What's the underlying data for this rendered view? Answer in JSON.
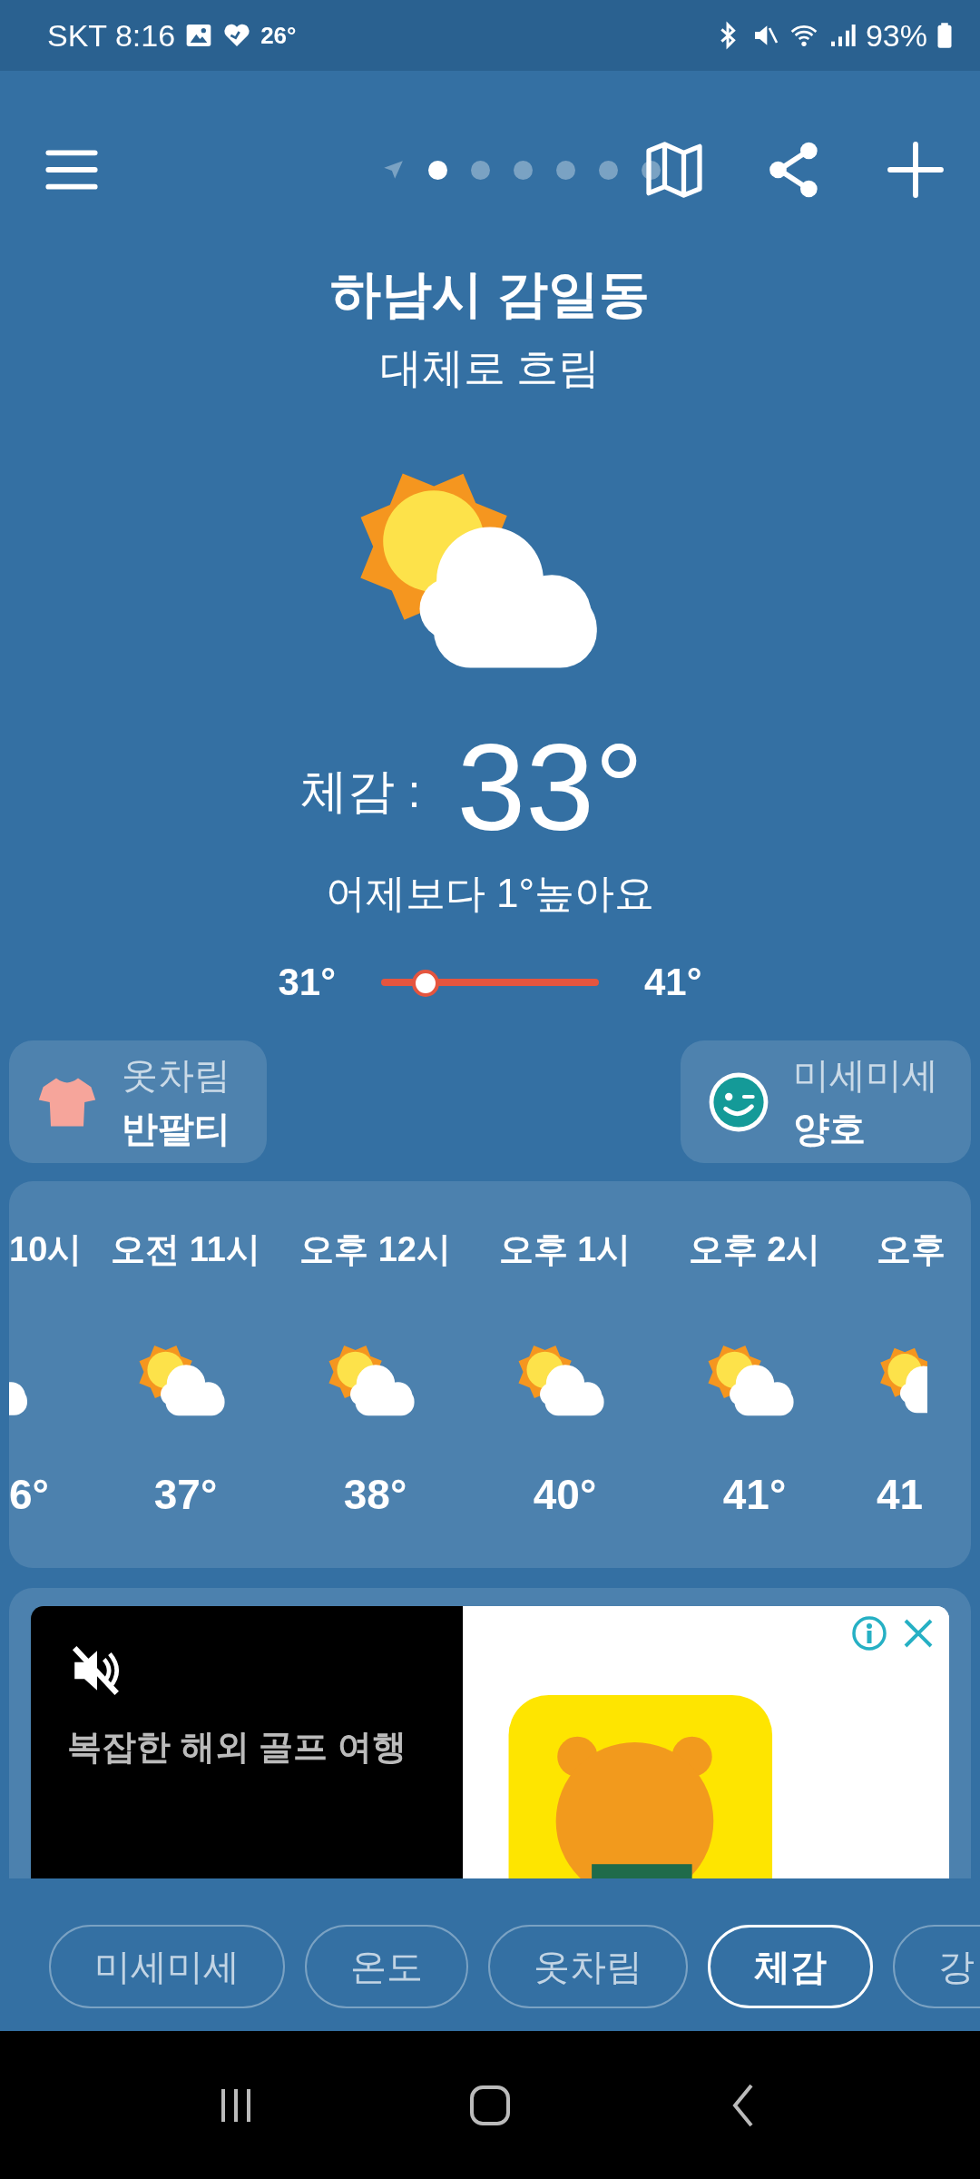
{
  "status_bar": {
    "carrier_time": "SKT 8:16",
    "temp": "26°",
    "battery": "93%"
  },
  "page_dots": [
    {
      "selected": true
    },
    {
      "selected": false
    },
    {
      "selected": false
    },
    {
      "selected": false
    },
    {
      "selected": false
    },
    {
      "selected": false
    }
  ],
  "location": {
    "name": "하남시 감일동",
    "condition": "대체로 흐림"
  },
  "feels_like": {
    "label": "체감 :",
    "value": "33°"
  },
  "comparison": "어제보다 1°높아요",
  "range": {
    "min": "31°",
    "max": "41°",
    "level": 0.2
  },
  "cards": [
    {
      "kind": "shirt",
      "title": "옷차림",
      "value": "반팔티"
    },
    {
      "kind": "dust",
      "title": "미세미세",
      "value": "양호"
    }
  ],
  "hourly": [
    {
      "time": "10시",
      "temp": "6°",
      "kind": "partial_start"
    },
    {
      "time": "오전 11시",
      "temp": "37°",
      "kind": "full"
    },
    {
      "time": "오후 12시",
      "temp": "38°",
      "kind": "full"
    },
    {
      "time": "오후 1시",
      "temp": "40°",
      "kind": "full"
    },
    {
      "time": "오후 2시",
      "temp": "41°",
      "kind": "full"
    },
    {
      "time": "오후",
      "temp": "41",
      "kind": "partial_end"
    }
  ],
  "ad": {
    "headline": "복잡한 해외 골프 여행"
  },
  "tabs": [
    {
      "label": "미세미세",
      "selected": false
    },
    {
      "label": "온도",
      "selected": false
    },
    {
      "label": "옷차림",
      "selected": false
    },
    {
      "label": "체감",
      "selected": true
    },
    {
      "label": "강",
      "selected": false
    }
  ]
}
